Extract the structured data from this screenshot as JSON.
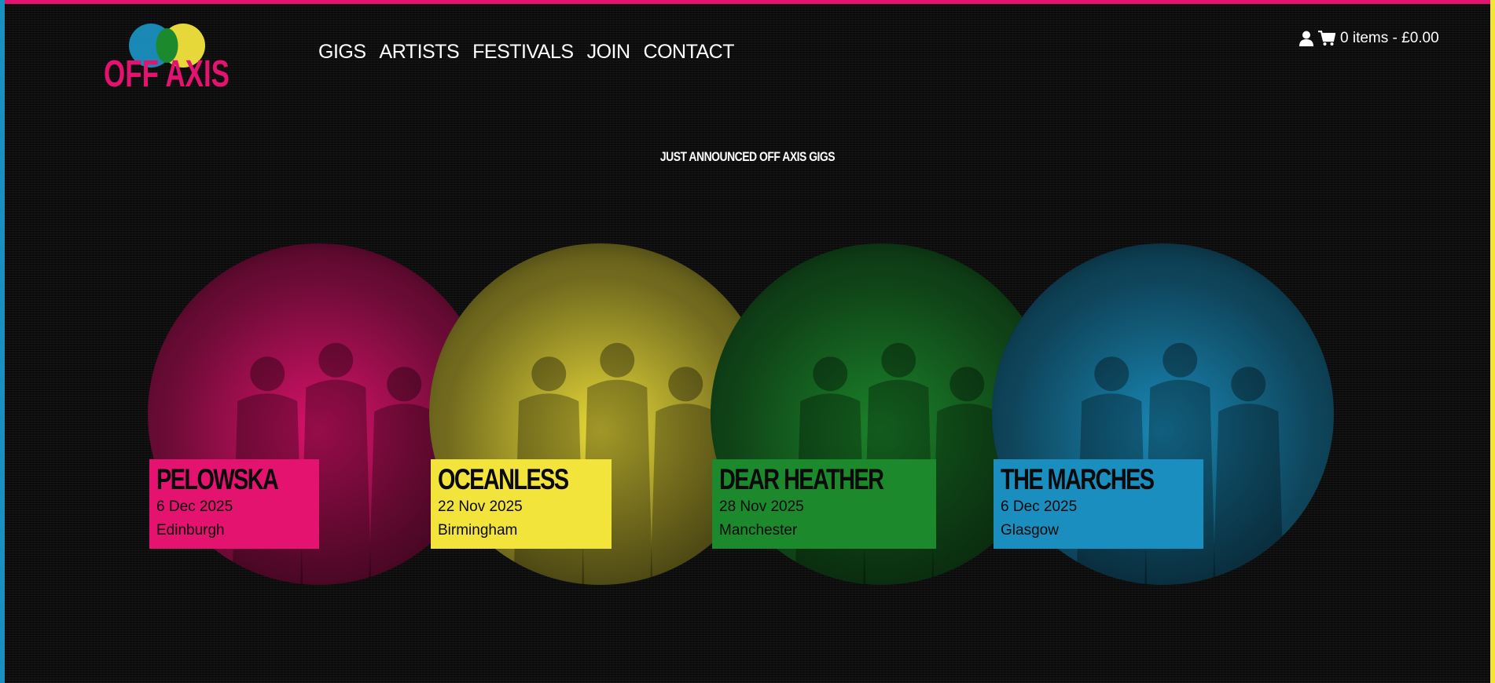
{
  "colors": {
    "pink": "#e3136f",
    "yellow": "#f3e43c",
    "green": "#1c8a2c",
    "blue": "#1a8fbf",
    "background": "#0b0b0b"
  },
  "logo": {
    "text": "OFF AXIS"
  },
  "nav": {
    "items": [
      "GIGS",
      "ARTISTS",
      "FESTIVALS",
      "JOIN",
      "CONTACT"
    ]
  },
  "cart": {
    "user_icon": "user-icon",
    "cart_icon": "shopping-cart-icon",
    "label": "0 items - £0.00"
  },
  "section": {
    "title": "JUST ANNOUNCED OFF AXIS GIGS"
  },
  "gigs": [
    {
      "artist": "PELOWSKA",
      "date": "6 Dec 2025",
      "city": "Edinburgh",
      "color": "#e3136f"
    },
    {
      "artist": "OCEANLESS",
      "date": "22 Nov 2025",
      "city": "Birmingham",
      "color": "#f3e43c"
    },
    {
      "artist": "DEAR HEATHER",
      "date": "28 Nov 2025",
      "city": "Manchester",
      "color": "#1c8a2c"
    },
    {
      "artist": "THE MARCHES",
      "date": "6 Dec 2025",
      "city": "Glasgow",
      "color": "#1a8fbf"
    }
  ]
}
